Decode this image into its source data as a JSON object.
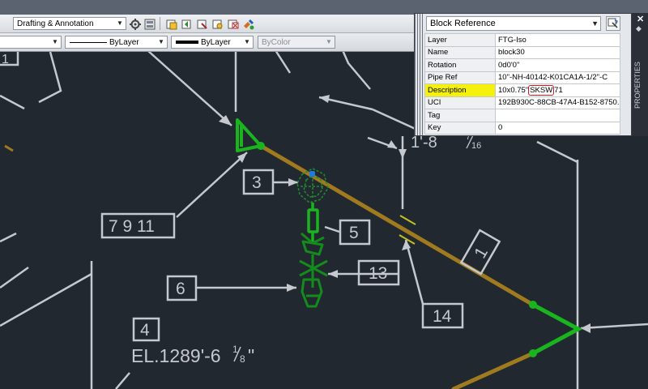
{
  "colors": {
    "background": "#212830",
    "annotation": "#c5c9ce",
    "pipe": "#a07a1e",
    "green": "#19b41e",
    "dark_green": "#148c1c",
    "grip": "#1e78e6",
    "highlight_yellow": "#f5f10d",
    "highlight_red": "#e0161a"
  },
  "toolbar": {
    "workspace": "Drafting & Annotation",
    "linetype": "ByLayer",
    "lineweight": "ByLayer",
    "plotstyle": "ByColor",
    "icons": [
      "gear-icon",
      "workspace-icon",
      "layer-state-icon",
      "layer-previous-icon",
      "layer-match-icon",
      "layer-isolate-icon",
      "layer-freeze-icon",
      "layer-tools-icon"
    ]
  },
  "properties": {
    "object_type": "Block Reference",
    "palette_title": "PROPERTIES",
    "rows": [
      {
        "key": "Layer",
        "value": "FTG-Iso"
      },
      {
        "key": "Name",
        "value": "block30"
      },
      {
        "key": "Rotation",
        "value": "0d0'0\""
      },
      {
        "key": "Pipe Ref",
        "value": "10\"-NH-40142-K01CA1A-1/2\"-C"
      },
      {
        "key": "Description",
        "value": "10x0.75\" SKSW 71",
        "value_pre": "10x0.75\"",
        "value_mark": "SKSW",
        "value_post": "71"
      },
      {
        "key": "UCI",
        "value": "192B930C-88CB-47A4-B152-8750..."
      },
      {
        "key": "Tag",
        "value": ""
      },
      {
        "key": "Key",
        "value": "0"
      }
    ]
  },
  "drawing": {
    "labels": {
      "balloon_3": "3",
      "balloon_7911": "7 9 11",
      "balloon_5": "5",
      "balloon_13": "13",
      "balloon_6": "6",
      "balloon_4": "4",
      "balloon_14": "14",
      "pipe_tag_1": "1",
      "balloon_topleft": "1",
      "elevation": "EL.1289'-6",
      "elevation_fraction_num": "1",
      "elevation_fraction_den": "8",
      "elevation_inch": "\"",
      "dim_text": "1'-8",
      "dim_fraction_num": "7",
      "dim_fraction_den": "16"
    }
  }
}
